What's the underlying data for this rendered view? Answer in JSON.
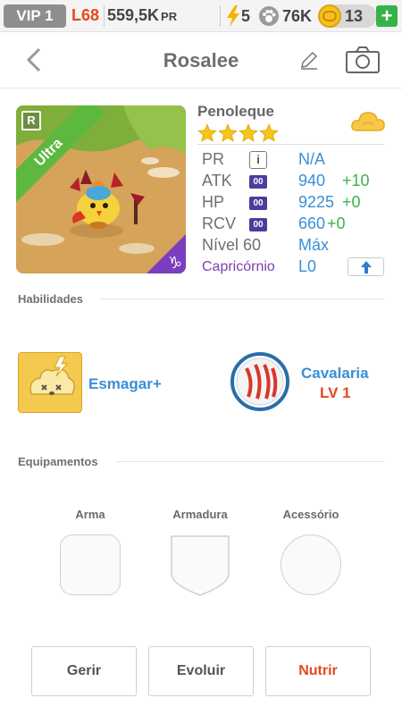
{
  "status": {
    "vip": "VIP 1",
    "level": "L68",
    "power": "559,5K",
    "power_unit": "PR",
    "energy": "5",
    "paws": "76K",
    "coins": "13",
    "plus": "+"
  },
  "header": {
    "title": "Rosalee"
  },
  "pet": {
    "species": "Penoleque",
    "stars": 4,
    "badge_r": "R",
    "rank_ribbon": "Ultra",
    "stats": {
      "pr_label": "PR",
      "pr_info": "i",
      "pr_value": "N/A",
      "atk_label": "ATK",
      "atk_tag": "00",
      "atk_value": "940",
      "atk_bonus": "+10",
      "hp_label": "HP",
      "hp_tag": "00",
      "hp_value": "9225",
      "hp_bonus": "+0",
      "rcv_label": "RCV",
      "rcv_tag": "00",
      "rcv_value": "660",
      "rcv_bonus": "+0",
      "level_label": "Nível 60",
      "level_value": "Máx",
      "zodiac_label": "Capricórnio",
      "zodiac_value": "L0"
    }
  },
  "abilities": {
    "title": "Habilidades",
    "skill1_name": "Esmagar+",
    "skill2_name": "Cavalaria",
    "skill2_level": "LV 1"
  },
  "equipment": {
    "title": "Equipamentos",
    "weapon": "Arma",
    "armor": "Armadura",
    "accessory": "Acessório"
  },
  "actions": {
    "manage": "Gerir",
    "evolve": "Evoluir",
    "feed": "Nutrir"
  },
  "colors": {
    "accent_blue": "#3a8fd6",
    "accent_red": "#e8481c",
    "bonus_green": "#3cb44b",
    "zodiac_purple": "#7d40b3",
    "ribbon_green": "#5cb83f",
    "star_yellow": "#f5c518"
  }
}
